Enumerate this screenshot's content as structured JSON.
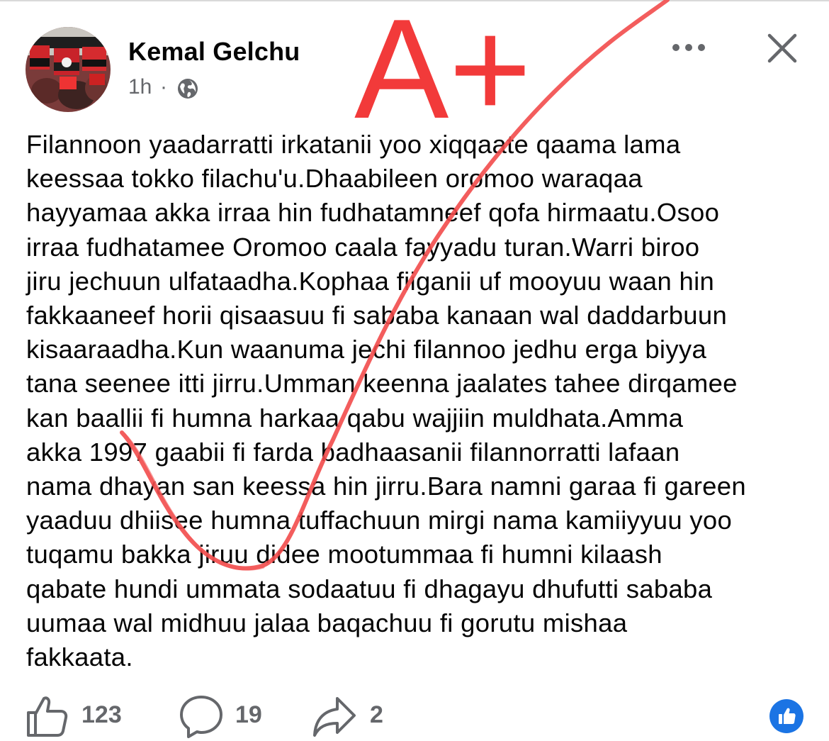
{
  "post": {
    "author": "Kemal Gelchu",
    "time": "1h",
    "separator": "·",
    "audience_icon": "globe-icon",
    "text": "Filannoon yaadarratti irkatanii yoo xiqqaate qaama lama\nkeessaa tokko filachu'u.Dhaabileen oromoo waraqaa\nhayyamaa akka irraa hin fudhatamneef qofa hirmaatu.Osoo\nirraa fudhatamee Oromoo caala fayyadu turan.Warri biroo\njiru jechuun ulfataadha.Kophaa fiiganii uf mooyuu waan hin\nfakkaaneef horii qisaasuu fi sababa kanaan wal daddarbuun\nkisaaraadha.Kun waanuma jechi filannoo jedhu erga biyya\ntana seenee itti jirru.Umman keenna jaalates tahee dirqamee\nkan baallii fi humna harkaa qabu wajjiin muldhata.Amma\nakka 1997 gaabii fi farda badhaasanii filannorratti lafaan\nnama dhayan san keessa hin jirru.Bara namni garaa fi gareen\nyaaduu dhiisee humna tuffachuun mirgi nama kamiiyyuu yoo\ntuqamu bakka jiruu didee mootummaa fi humni kilaash\nqabate hundi ummata sodaatuu fi dhagayu dhufutti sababa\nuumaa wal midhuu jalaa baqachuu fi gorutu mishaa\nfakkaata.",
    "annotation": "A+",
    "annotation_color": "#f23a3a"
  },
  "header_actions": {
    "more_icon": "more-horizontal-icon",
    "close_icon": "close-icon"
  },
  "actions": {
    "likes": "123",
    "comments": "19",
    "shares": "2"
  },
  "colors": {
    "text": "#050505",
    "secondary": "#65676b",
    "accent": "#1b74e4"
  }
}
